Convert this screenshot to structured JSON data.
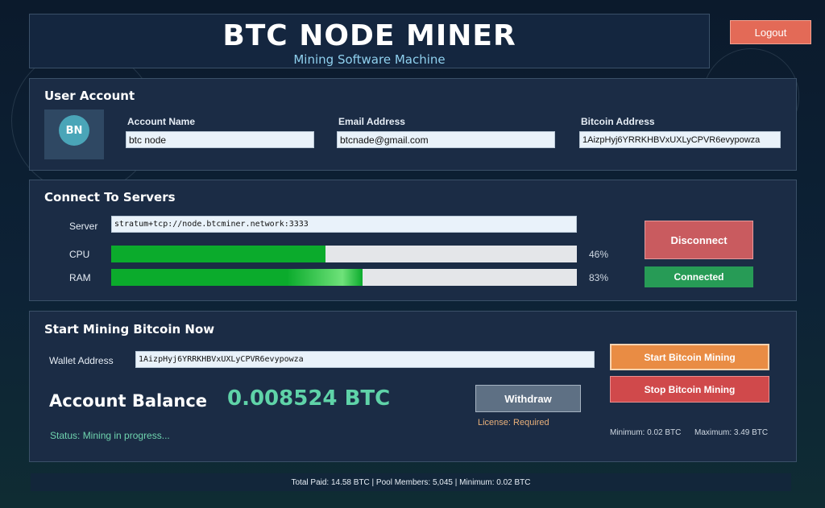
{
  "header": {
    "title": "BTC NODE MINER",
    "subtitle": "Mining Software Machine",
    "logout_label": "Logout"
  },
  "user_account": {
    "title": "User Account",
    "avatar_initials": "BN",
    "account_name_label": "Account Name",
    "account_name_value": "btc node",
    "email_label": "Email Address",
    "email_value": "btcnade@gmail.com",
    "bitcoin_label": "Bitcoin Address",
    "bitcoin_value": "1AizpHyj6YRRKHBVxUXLyCPVR6evypowza"
  },
  "servers": {
    "title": "Connect To Servers",
    "server_label": "Server",
    "server_value": "stratum+tcp://node.btcminer.network:3333",
    "cpu_label": "CPU",
    "cpu_percent_text": "46%",
    "cpu_fill_fraction": 0.46,
    "ram_label": "RAM",
    "ram_percent_text": "83%",
    "ram_fill_fraction": 0.54,
    "disconnect_label": "Disconnect",
    "connected_label": "Connected"
  },
  "mining": {
    "title": "Start Mining Bitcoin Now",
    "wallet_label": "Wallet Address",
    "wallet_value": "1AizpHyj6YRRKHBVxUXLyCPVR6evypowza",
    "balance_label": "Account Balance",
    "balance_value": "0.008524 BTC",
    "withdraw_label": "Withdraw",
    "license_text": "License: Required",
    "start_label": "Start Bitcoin Mining",
    "stop_label": "Stop Bitcoin Mining",
    "minimum_text": "Minimum: 0.02 BTC",
    "maximum_text": "Maximum: 3.49 BTC",
    "status_text": "Status: Mining in progress..."
  },
  "footer": {
    "text": "Total Paid: 14.58 BTC | Pool Members: 5,045 | Minimum: 0.02 BTC"
  },
  "colors": {
    "accent_green": "#5fd3a8",
    "bar_green": "#0bab2c",
    "danger_red": "#d0494b",
    "start_orange": "#e98c44"
  }
}
